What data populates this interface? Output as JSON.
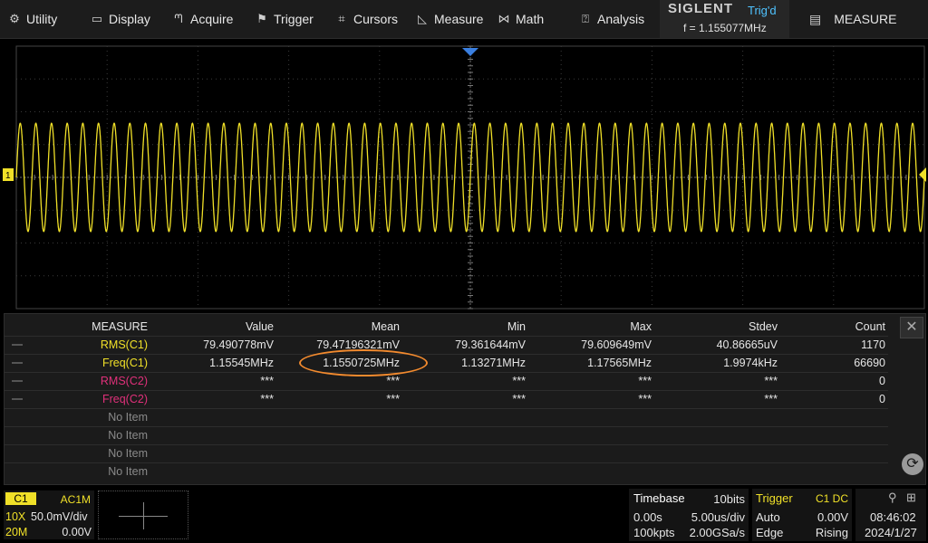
{
  "menu": {
    "items": [
      {
        "label": "Utility",
        "icon": "gear-icon"
      },
      {
        "label": "Display",
        "icon": "monitor-icon"
      },
      {
        "label": "Acquire",
        "icon": "acquire-icon"
      },
      {
        "label": "Trigger",
        "icon": "flag-icon"
      },
      {
        "label": "Cursors",
        "icon": "crosshair-icon"
      },
      {
        "label": "Measure",
        "icon": "ruler-icon"
      },
      {
        "label": "Math",
        "icon": "math-icon"
      },
      {
        "label": "Analysis",
        "icon": "analysis-icon"
      }
    ],
    "brand": "SIGLENT",
    "trigger_status": "Trig'd",
    "frequency_readout": "f = 1.155077MHz",
    "active_menu": "MEASURE"
  },
  "waveform": {
    "trace_color": "#f0e028",
    "channel_marker": "1",
    "trigger_marker_color": "#3a7fe0",
    "cycles_visible": 58,
    "amplitude_div": 3.3
  },
  "measure_table": {
    "headers": [
      "MEASURE",
      "Value",
      "Mean",
      "Min",
      "Max",
      "Stdev",
      "Count"
    ],
    "rows": [
      {
        "name": "RMS(C1)",
        "color": "#f0e028",
        "values": [
          "79.490778mV",
          "79.47196321mV",
          "79.361644mV",
          "79.609649mV",
          "40.86665uV",
          "1170"
        ]
      },
      {
        "name": "Freq(C1)",
        "color": "#f0e028",
        "values": [
          "1.15545MHz",
          "1.1550725MHz",
          "1.13271MHz",
          "1.17565MHz",
          "1.9974kHz",
          "66690"
        ]
      },
      {
        "name": "RMS(C2)",
        "color": "#e0307a",
        "values": [
          "***",
          "***",
          "***",
          "***",
          "***",
          "0"
        ]
      },
      {
        "name": "Freq(C2)",
        "color": "#e0307a",
        "values": [
          "***",
          "***",
          "***",
          "***",
          "***",
          "0"
        ]
      }
    ],
    "empty_rows": [
      "No Item",
      "No Item",
      "No Item",
      "No Item"
    ],
    "close_icon": "close-icon",
    "refresh_icon": "refresh-icon"
  },
  "channel1": {
    "tag": "C1",
    "coupling": "AC1M",
    "probe": "10X",
    "scale": "50.0mV/div",
    "bandwidth": "20M",
    "offset": "0.00V"
  },
  "timebase": {
    "title": "Timebase",
    "bits": "10bits",
    "delay": "0.00s",
    "scale": "5.00us/div",
    "memory": "100kpts",
    "sample_rate": "2.00GSa/s"
  },
  "trigger": {
    "title": "Trigger",
    "source": "C1 DC",
    "mode": "Auto",
    "level": "0.00V",
    "type": "Edge",
    "slope": "Rising"
  },
  "clock": {
    "time": "08:46:02",
    "date": "2024/1/27"
  }
}
